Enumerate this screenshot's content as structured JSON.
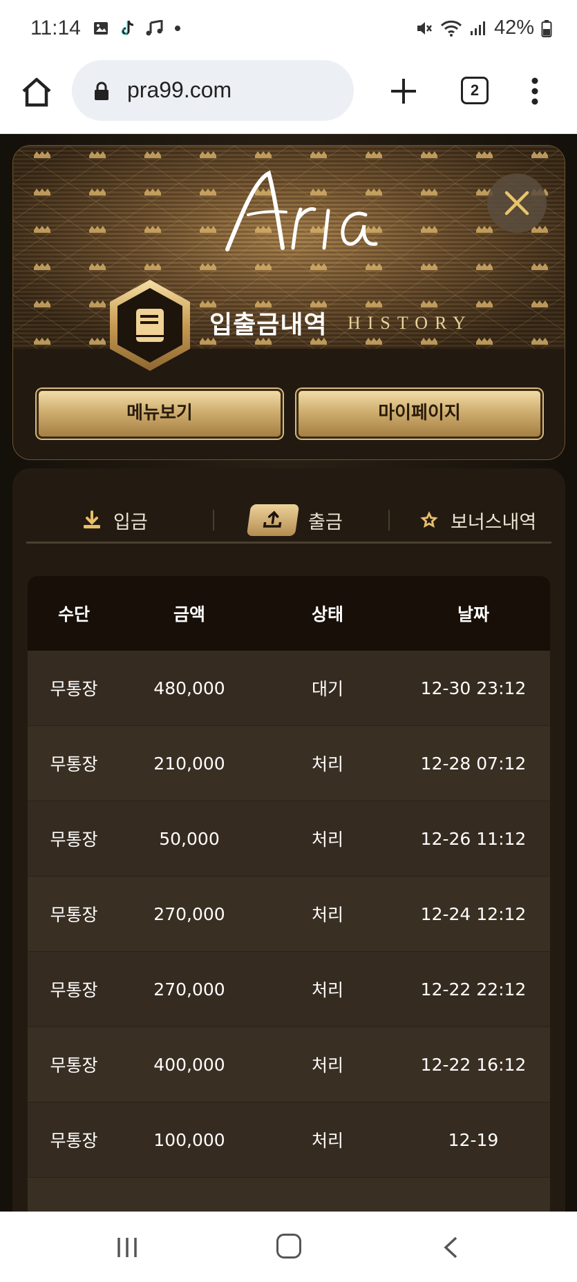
{
  "status_bar": {
    "time": "11:14",
    "battery": "42%"
  },
  "browser": {
    "url": "pra99.com",
    "tab_count": "2"
  },
  "header": {
    "title_ko": "입출금내역",
    "title_en": "HISTORY",
    "menu_button": "메뉴보기",
    "mypage_button": "마이페이지"
  },
  "tabs": {
    "deposit": "입금",
    "withdraw": "출금",
    "bonus": "보너스내역",
    "active": "withdraw"
  },
  "table": {
    "headers": [
      "수단",
      "금액",
      "상태",
      "날짜"
    ],
    "rows": [
      {
        "method": "무통장",
        "amount": "480,000",
        "status": "대기",
        "date": "12-30 23:12"
      },
      {
        "method": "무통장",
        "amount": "210,000",
        "status": "처리",
        "date": "12-28 07:12"
      },
      {
        "method": "무통장",
        "amount": "50,000",
        "status": "처리",
        "date": "12-26 11:12"
      },
      {
        "method": "무통장",
        "amount": "270,000",
        "status": "처리",
        "date": "12-24 12:12"
      },
      {
        "method": "무통장",
        "amount": "270,000",
        "status": "처리",
        "date": "12-22 22:12"
      },
      {
        "method": "무통장",
        "amount": "400,000",
        "status": "처리",
        "date": "12-22 16:12"
      },
      {
        "method": "무통장",
        "amount": "100,000",
        "status": "처리",
        "date": "12-19"
      }
    ]
  },
  "colors": {
    "gold_accent": "#e9d19a",
    "card_bg": "#231b12",
    "row_bg": "#3a2f23"
  }
}
